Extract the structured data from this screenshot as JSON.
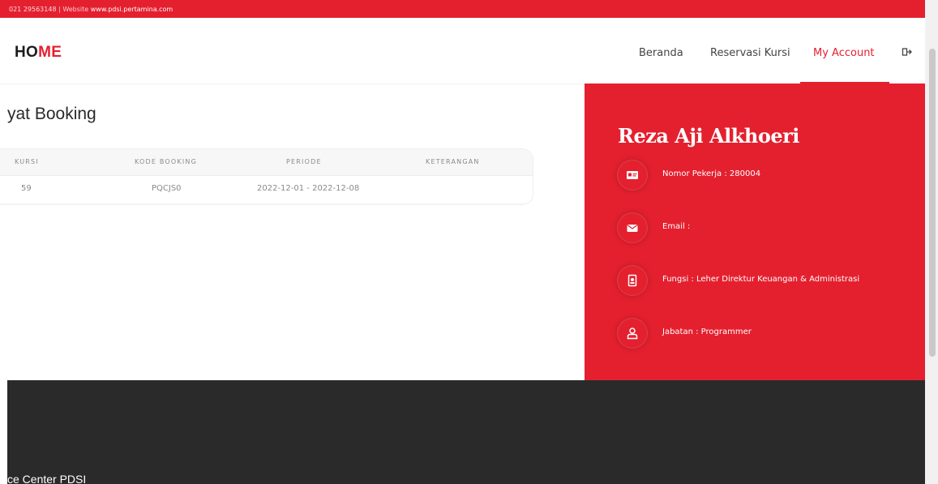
{
  "topbar": {
    "phone": "021 29563148",
    "separator": " | ",
    "website_label": "Website ",
    "website_url": "www.pdsi.pertamina.com"
  },
  "header": {
    "brand_part1": "HO",
    "brand_part2": "ME",
    "nav": [
      {
        "label": "Beranda"
      },
      {
        "label": "Reservasi Kursi"
      },
      {
        "label": "My Account",
        "active": true
      }
    ],
    "logout_icon": "logout-icon"
  },
  "main": {
    "title": "yat Booking",
    "table": {
      "headers": [
        "KURSI",
        "KODE BOOKING",
        "PERIODE",
        "KETERANGAN"
      ],
      "rows": [
        {
          "kursi": "59",
          "kode": "PQCJS0",
          "periode": "2022-12-01 - 2022-12-08",
          "keterangan": ""
        }
      ]
    }
  },
  "profile": {
    "name": "Reza Aji Alkhoeri",
    "items": [
      {
        "icon": "id-card-icon",
        "text": "Nomor Pekerja : 280004"
      },
      {
        "icon": "envelope-icon",
        "text": "Email :"
      },
      {
        "icon": "badge-icon",
        "text": "Fungsi : Leher Direktur Keuangan & Administrasi"
      },
      {
        "icon": "user-icon",
        "text": "Jabatan : Programmer"
      }
    ]
  },
  "footer": {
    "text": "ce Center PDSI"
  },
  "colors": {
    "accent": "#e4202f",
    "footer_bg": "#2a2a2a"
  }
}
